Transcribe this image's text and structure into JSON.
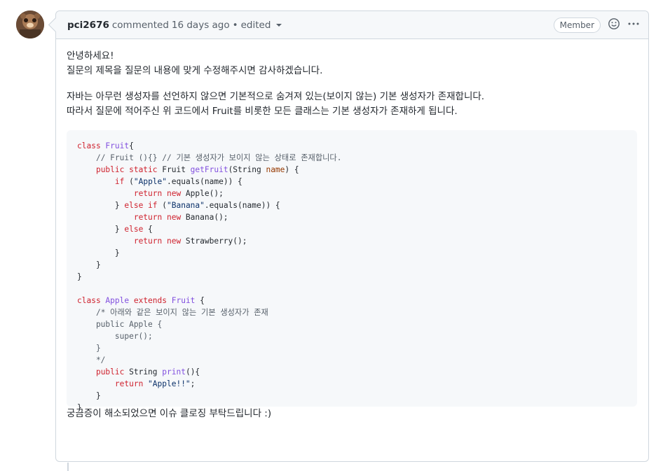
{
  "comment": {
    "author": "pci2676",
    "action": "commented",
    "time": "16 days ago",
    "edited": "edited",
    "badge": "Member",
    "paragraphs": [
      "안녕하세요!",
      "질문의 제목을 질문의 내용에 맞게 수정해주시면 감사하겠습니다.",
      "자바는 아무런 생성자를 선언하지 않으면 기본적으로 숨겨져 있는(보이지 않는) 기본 생성자가 존재합니다.",
      "따라서 질문에 적어주신 위 코드에서 Fruit를 비롯한 모든 클래스는 기본 생성자가 존재하게 됩니다."
    ],
    "closing": "궁금증이 해소되었으면 이슈 클로징 부탁드립니다 :)",
    "code": [
      [
        [
          "kw",
          "class "
        ],
        [
          "cls",
          "Fruit"
        ],
        [
          "",
          "{"
        ]
      ],
      [
        [
          "",
          "    "
        ],
        [
          "cmt",
          "// Fruit (){} // 기본 생성자가 보이지 않는 상태로 존재합니다."
        ]
      ],
      [
        [
          "",
          "    "
        ],
        [
          "kw",
          "public static "
        ],
        [
          "",
          "Fruit "
        ],
        [
          "fn",
          "getFruit"
        ],
        [
          "",
          "(String "
        ],
        [
          "prm",
          "name"
        ],
        [
          "",
          ") {"
        ]
      ],
      [
        [
          "",
          "        "
        ],
        [
          "kw",
          "if "
        ],
        [
          "",
          "("
        ],
        [
          "str",
          "\"Apple\""
        ],
        [
          "",
          ".equals(name)) {"
        ]
      ],
      [
        [
          "",
          "            "
        ],
        [
          "kw",
          "return new "
        ],
        [
          "",
          "Apple();"
        ]
      ],
      [
        [
          "",
          "        } "
        ],
        [
          "kw",
          "else if "
        ],
        [
          "",
          "("
        ],
        [
          "str",
          "\"Banana\""
        ],
        [
          "",
          ".equals(name)) {"
        ]
      ],
      [
        [
          "",
          "            "
        ],
        [
          "kw",
          "return new "
        ],
        [
          "",
          "Banana();"
        ]
      ],
      [
        [
          "",
          "        } "
        ],
        [
          "kw",
          "else "
        ],
        [
          "",
          "{"
        ]
      ],
      [
        [
          "",
          "            "
        ],
        [
          "kw",
          "return new "
        ],
        [
          "",
          "Strawberry();"
        ]
      ],
      [
        [
          "",
          "        }"
        ]
      ],
      [
        [
          "",
          "    }"
        ]
      ],
      [
        [
          "",
          "}"
        ]
      ],
      [
        [
          "",
          ""
        ]
      ],
      [
        [
          "kw",
          "class "
        ],
        [
          "cls",
          "Apple "
        ],
        [
          "kw",
          "extends "
        ],
        [
          "cls",
          "Fruit "
        ],
        [
          "",
          "{"
        ]
      ],
      [
        [
          "",
          "    "
        ],
        [
          "cmt",
          "/* 아래와 같은 보이지 않는 기본 생성자가 존재"
        ]
      ],
      [
        [
          "cmt",
          "    public Apple {"
        ]
      ],
      [
        [
          "cmt",
          "        super();"
        ]
      ],
      [
        [
          "cmt",
          "    }"
        ]
      ],
      [
        [
          "cmt",
          "    */"
        ]
      ],
      [
        [
          "",
          "    "
        ],
        [
          "kw",
          "public "
        ],
        [
          "",
          "String "
        ],
        [
          "fn",
          "print"
        ],
        [
          "",
          "(){"
        ]
      ],
      [
        [
          "",
          "        "
        ],
        [
          "kw",
          "return "
        ],
        [
          "str",
          "\"Apple!!\""
        ],
        [
          "",
          ";"
        ]
      ],
      [
        [
          "",
          "    }"
        ]
      ],
      [
        [
          "",
          "}"
        ]
      ]
    ]
  },
  "icons": {
    "emoji": "smiley-icon",
    "more": "kebab-horizontal-icon",
    "caret": "caret-down-icon"
  }
}
